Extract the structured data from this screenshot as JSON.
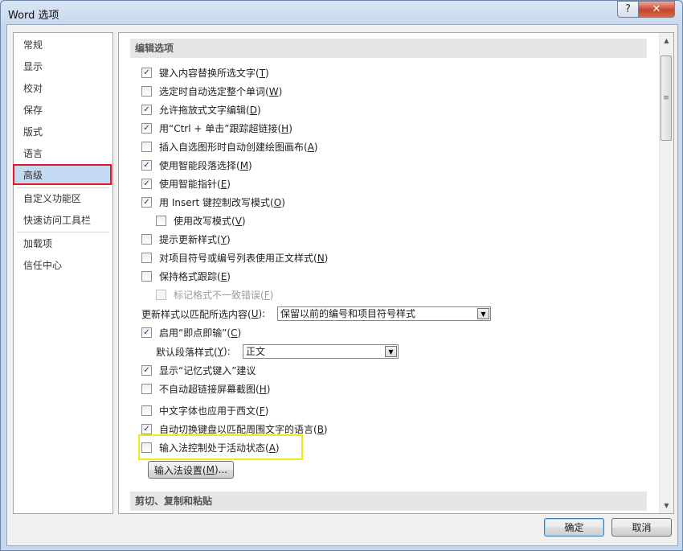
{
  "window": {
    "title": "Word 选项",
    "help_button": "?",
    "close_button": "✕"
  },
  "nav": {
    "items": [
      {
        "label": "常规"
      },
      {
        "label": "显示"
      },
      {
        "label": "校对"
      },
      {
        "label": "保存"
      },
      {
        "label": "版式"
      },
      {
        "label": "语言"
      },
      {
        "label": "高级",
        "selected": true
      },
      {
        "label": "自定义功能区"
      },
      {
        "label": "快速访问工具栏"
      },
      {
        "label": "加载项"
      },
      {
        "label": "信任中心"
      }
    ]
  },
  "sections": {
    "editing": "编辑选项",
    "clipboard": "剪切、复制和粘贴"
  },
  "options": [
    {
      "checked": true,
      "text": "键入内容替换所选文字(",
      "key": "T",
      "tail": ")"
    },
    {
      "checked": false,
      "text": "选定时自动选定整个单词(",
      "key": "W",
      "tail": ")"
    },
    {
      "checked": true,
      "text": "允许拖放式文字编辑(",
      "key": "D",
      "tail": ")"
    },
    {
      "checked": true,
      "text": "用“Ctrl + 单击”跟踪超链接(",
      "key": "H",
      "tail": ")"
    },
    {
      "checked": false,
      "text": "插入自选图形时自动创建绘图画布(",
      "key": "A",
      "tail": ")"
    },
    {
      "checked": true,
      "text": "使用智能段落选择(",
      "key": "M",
      "tail": ")"
    },
    {
      "checked": true,
      "text": "使用智能指针(",
      "key": "E",
      "tail": ")"
    },
    {
      "checked": true,
      "text": "用 Insert 键控制改写模式(",
      "key": "O",
      "tail": ")"
    },
    {
      "checked": false,
      "text": "使用改写模式(",
      "key": "V",
      "tail": ")"
    },
    {
      "checked": false,
      "text": "提示更新样式(",
      "key": "Y",
      "tail": ")"
    },
    {
      "checked": false,
      "text": "对项目符号或编号列表使用正文样式(",
      "key": "N",
      "tail": ")"
    },
    {
      "checked": false,
      "text": "保持格式跟踪(",
      "key": "E",
      "tail": ")"
    },
    {
      "checked": false,
      "disabled": true,
      "text": "标记格式不一致错误(",
      "key": "F",
      "tail": ")"
    }
  ],
  "update_style": {
    "label": "更新样式以匹配所选内容(",
    "key": "U",
    "tail": "):",
    "value": "保留以前的编号和项目符号样式"
  },
  "click_and_type": {
    "checked": true,
    "text": "启用“即点即输”(",
    "key": "C",
    "tail": ")"
  },
  "default_para": {
    "label": "默认段落样式(",
    "key": "Y",
    "tail": "):",
    "value": "正文"
  },
  "options2": [
    {
      "checked": true,
      "text": "显示“记忆式键入”建议",
      "key": "",
      "tail": ""
    },
    {
      "checked": false,
      "text": "不自动超链接屏幕截图(",
      "key": "H",
      "tail": ")"
    },
    {
      "checked": false,
      "text": "中文字体也应用于西文(",
      "key": "F",
      "tail": ")"
    },
    {
      "checked": true,
      "text": "自动切换键盘以匹配周围文字的语言(",
      "key": "B",
      "tail": ")"
    },
    {
      "checked": false,
      "text": "输入法控制处于活动状态(",
      "key": "A",
      "tail": ")"
    }
  ],
  "ime_button": {
    "text": "输入法设置(",
    "key": "M",
    "tail": ")..."
  },
  "footer": {
    "ok": "确定",
    "cancel": "取消"
  },
  "glyphs": {
    "check": "✓",
    "dropdown": "▼",
    "scroll_up": "▲",
    "scroll_down": "▼",
    "thumb_grip": "≡"
  }
}
